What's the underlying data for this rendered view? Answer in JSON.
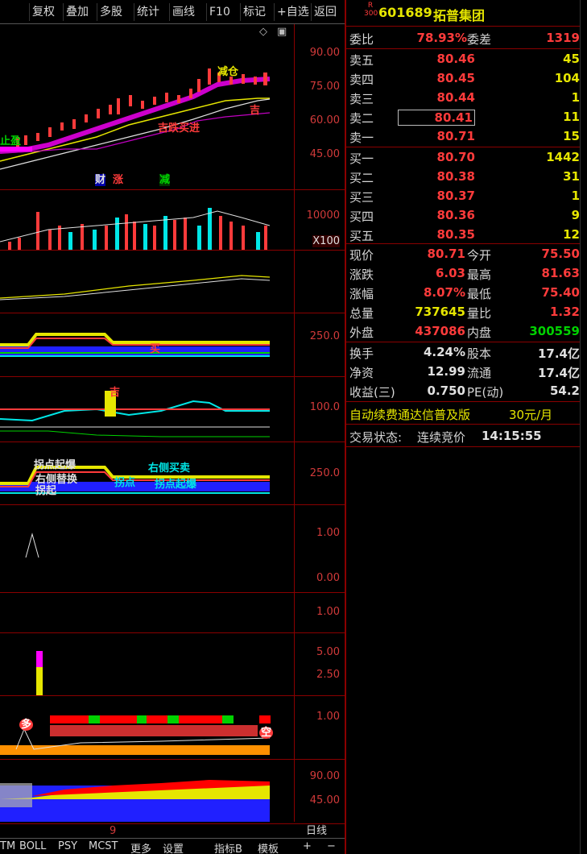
{
  "toolbar": {
    "buttons": [
      "复权",
      "叠加",
      "多股",
      "统计",
      "画线",
      "F10",
      "标记",
      "+自选",
      "返回"
    ]
  },
  "stock": {
    "index_badge_top": "R",
    "index_badge_bottom": "300",
    "code": "601689",
    "name": "拓普集团"
  },
  "ratio": {
    "wb_label": "委比",
    "wb_value": "78.93%",
    "wc_label": "委差",
    "wc_value": "1319"
  },
  "sell_orders": [
    {
      "label": "卖五",
      "price": "80.46",
      "volume": "45"
    },
    {
      "label": "卖四",
      "price": "80.45",
      "volume": "104"
    },
    {
      "label": "卖三",
      "price": "80.44",
      "volume": "1"
    },
    {
      "label": "卖二",
      "price": "80.41",
      "volume": "11"
    },
    {
      "label": "卖一",
      "price": "80.71",
      "volume": "15"
    }
  ],
  "buy_orders": [
    {
      "label": "买一",
      "price": "80.70",
      "volume": "1442"
    },
    {
      "label": "买二",
      "price": "80.38",
      "volume": "31"
    },
    {
      "label": "买三",
      "price": "80.37",
      "volume": "1"
    },
    {
      "label": "买四",
      "price": "80.36",
      "volume": "9"
    },
    {
      "label": "买五",
      "price": "80.35",
      "volume": "12"
    }
  ],
  "stats": [
    {
      "l1": "现价",
      "v1": "80.71",
      "l2": "今开",
      "v2": "75.50"
    },
    {
      "l1": "涨跌",
      "v1": "6.03",
      "l2": "最高",
      "v2": "81.63"
    },
    {
      "l1": "涨幅",
      "v1": "8.07%",
      "l2": "最低",
      "v2": "75.40"
    },
    {
      "l1": "总量",
      "v1": "737645",
      "l2": "量比",
      "v2": "1.32"
    },
    {
      "l1": "外盘",
      "v1": "437086",
      "l2": "内盘",
      "v2": "300559"
    }
  ],
  "fundamentals": [
    {
      "l1": "换手",
      "v1": "4.24%",
      "l2": "股本",
      "v2": "17.4亿"
    },
    {
      "l1": "净资",
      "v1": "12.99",
      "l2": "流通",
      "v2": "17.4亿"
    },
    {
      "l1": "收益(三)",
      "v1": "0.750",
      "l2": "PE(动)",
      "v2": "54.2"
    }
  ],
  "promo": {
    "text": "自动续费通达信普及版",
    "price": "30元/月"
  },
  "trade_status": {
    "label": "交易状态:",
    "value": "连续竞价",
    "time": "14:15:55"
  },
  "axis_labels": {
    "main": [
      "90.00",
      "75.00",
      "60.00",
      "45.00"
    ],
    "volume": [
      "10000",
      "X100"
    ],
    "p3": [
      "250.0"
    ],
    "p4": [
      "100.0"
    ],
    "p5": [
      "250.0"
    ],
    "p6": [
      "1.00",
      "0.00"
    ],
    "p7": [
      "1.00"
    ],
    "p8": [
      "5.00",
      "2.50"
    ],
    "p9": [
      "1.00"
    ],
    "p10": [
      "90.00",
      "45.00"
    ]
  },
  "chart_labels": {
    "jianchang": "减仓",
    "zhiying": "止盈",
    "fei": "财",
    "zhang": "涨",
    "jian": "减",
    "duodi": "吉跌买进",
    "qianshou": "吉",
    "mai": "买",
    "ql": "吉",
    "k": "拐点",
    "gdqb": "拐点起爆",
    "ycmm": "右侧买卖",
    "jiaqi": "拐点起爆",
    "rbx": "右侧替换",
    "sqi": "拐起",
    "duo": "多",
    "kong": "空",
    "bottom_tick": "9",
    "period": "日线"
  },
  "bottom_tabs": [
    "TM",
    "BOLL",
    "PSY",
    "MCST",
    "更多",
    "设置",
    "指标B",
    "模板",
    "+",
    "−"
  ],
  "colors": {
    "red": "#ff3b3b",
    "green": "#00d200",
    "yellow": "#e6e600",
    "cyan": "#00e6e6",
    "magenta": "#ff00ff",
    "blue": "#2020ff",
    "orange": "#ff9000",
    "white": "#e0e0e0"
  }
}
